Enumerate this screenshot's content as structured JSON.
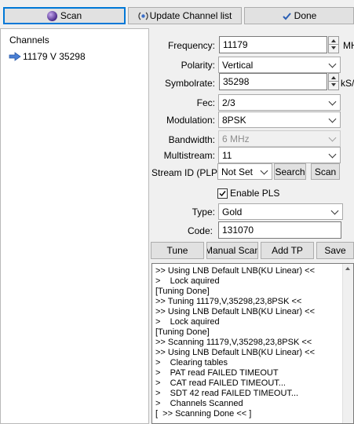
{
  "toolbar": {
    "scan_label": "Scan",
    "update_label": "Update Channel list",
    "done_label": "Done"
  },
  "channels": {
    "header": "Channels",
    "items": [
      "11179 V 35298"
    ]
  },
  "form": {
    "frequency": {
      "label": "Frequency:",
      "value": "11179",
      "unit": "MHz"
    },
    "polarity": {
      "label": "Polarity:",
      "value": "Vertical"
    },
    "symbolrate": {
      "label": "Symbolrate:",
      "value": "35298",
      "unit": "kS/s"
    },
    "fec": {
      "label": "Fec:",
      "value": "2/3"
    },
    "modulation": {
      "label": "Modulation:",
      "value": "8PSK"
    },
    "bandwidth": {
      "label": "Bandwidth:",
      "value": "6 MHz"
    },
    "multistream": {
      "label": "Multistream:",
      "value": "11"
    },
    "stream_id": {
      "label": "Stream ID (PLP):",
      "value": "Not Set",
      "search_label": "Search",
      "scan_label": "Scan"
    },
    "enable_pls": {
      "label": "Enable PLS",
      "checked": true
    },
    "type": {
      "label": "Type:",
      "value": "Gold"
    },
    "code": {
      "label": "Code:",
      "value": "131070"
    }
  },
  "actions": {
    "tune": "Tune",
    "manual_scan": "Manual Scan",
    "add_tp": "Add TP",
    "save": "Save"
  },
  "log": [
    ">> Using LNB Default LNB(KU Linear) <<",
    ">    Lock aquired",
    "[Tuning Done]",
    ">> Tuning 11179,V,35298,23,8PSK <<",
    ">> Using LNB Default LNB(KU Linear) <<",
    ">    Lock aquired",
    "[Tuning Done]",
    ">> Scanning 11179,V,35298,23,8PSK <<",
    ">> Using LNB Default LNB(KU Linear) <<",
    ">    Clearing tables",
    ">    PAT read FAILED TIMEOUT",
    ">    CAT read FAILED TIMEOUT...",
    ">    SDT 42 read FAILED TIMEOUT...",
    ">    Channels Scanned",
    "[  >> Scanning Done << ]"
  ],
  "colors": {
    "accent": "#0078d7",
    "arrow": "#3b6fc8"
  }
}
